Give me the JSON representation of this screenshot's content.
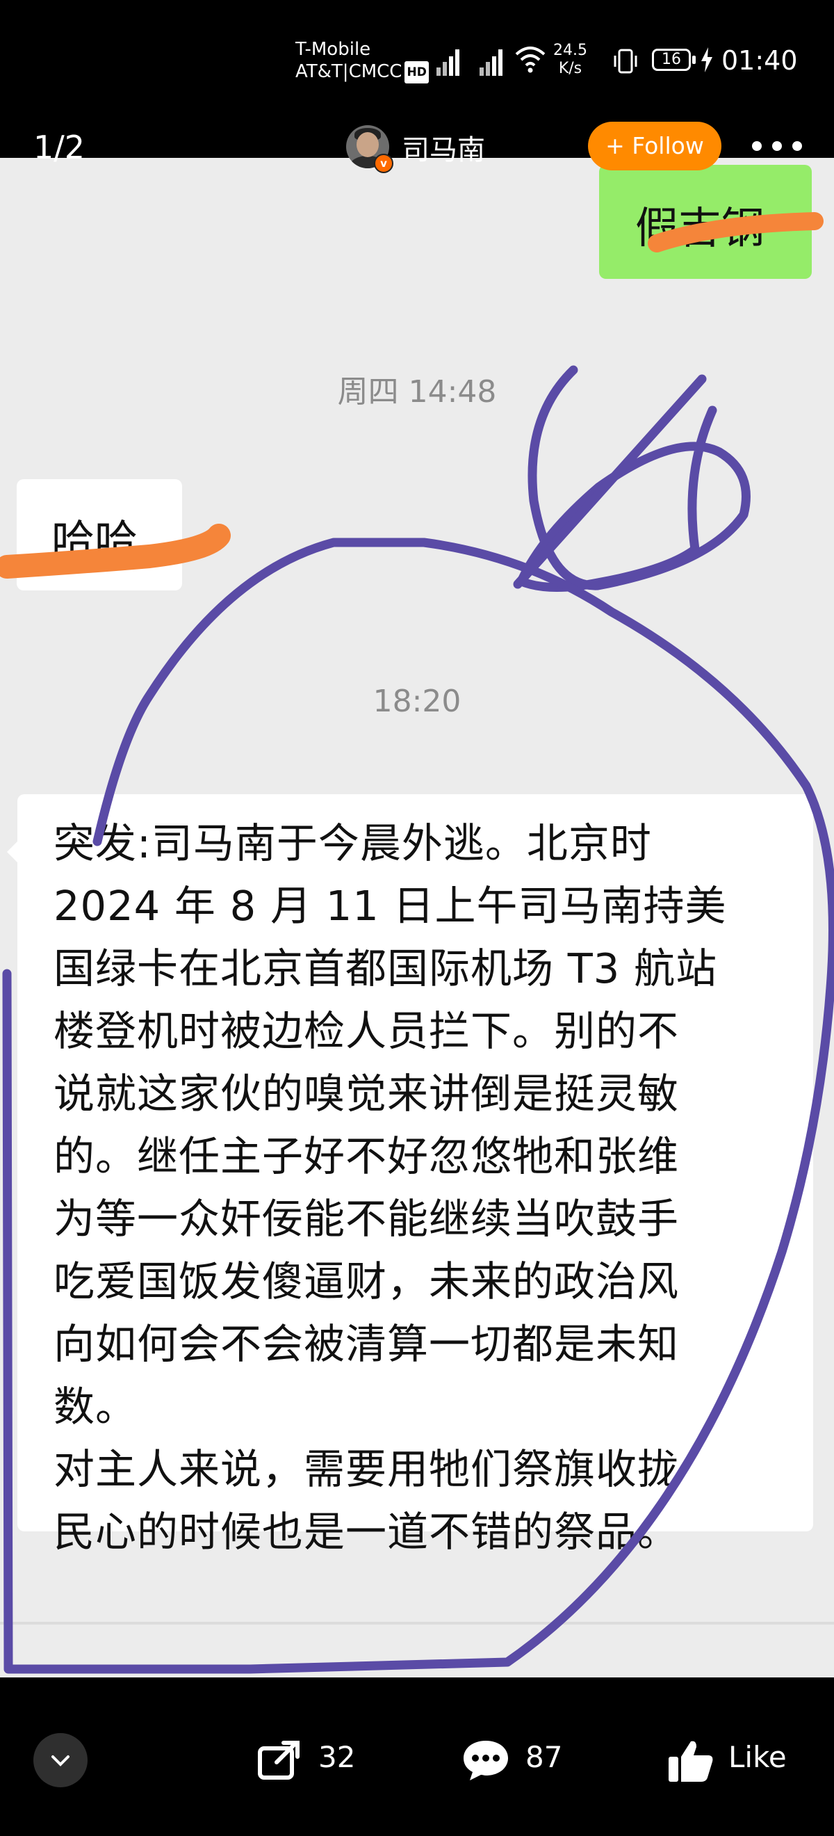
{
  "status_bar": {
    "carrier_line1": "T-Mobile",
    "carrier_line2": "AT&T|CMCC",
    "hd_badge": "HD",
    "network_speed_value": "24.5",
    "network_speed_unit": "K/s",
    "battery": "16",
    "time": "01:40"
  },
  "header": {
    "page_counter": "1/2",
    "author_name": "司马南",
    "follow_label": "+ Follow",
    "more_icon": "more-dots-icon"
  },
  "chat": {
    "sent_bubble_text": "假吉钢",
    "timestamp_1": "周四 14:48",
    "received_bubble_1_text": "哈哈",
    "timestamp_2": "18:20",
    "received_bubble_2_text": "突发:司马南于今晨外逃。北京时\n2024 年 8 月 11 日上午司马南持美\n国绿卡在北京首都国际机场 T3 航站\n楼登机时被边检人员拦下。别的不\n说就这家伙的嗅觉来讲倒是挺灵敏\n的。继任主子好不好忽悠牠和张维\n为等一众奸佞能不能继续当吹鼓手\n吃爱国饭发傻逼财，未来的政治风\n向如何会不会被清算一切都是未知\n数。\n对主人来说，需要用牠们祭旗收拢\n民心的时候也是一道不错的祭品。"
  },
  "bottom_bar": {
    "collapse_icon": "chevron-down-icon",
    "share_count": "32",
    "comment_count": "87",
    "like_label": "Like"
  },
  "colors": {
    "follow_button": "#ff8a00",
    "sent_bubble": "#95ec69",
    "chat_background": "#ececec",
    "scribble_purple": "#5a4ba6",
    "scribble_orange": "#f5853a"
  }
}
